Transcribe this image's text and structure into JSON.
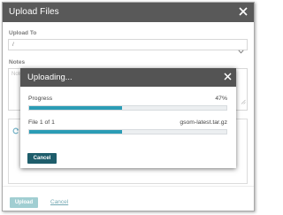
{
  "dialog": {
    "title": "Upload Files",
    "upload_to": {
      "label": "Upload To",
      "value": "/"
    },
    "notes": {
      "label": "Notes",
      "placeholder": "Notes"
    },
    "footer": {
      "upload_label": "Upload",
      "cancel_label": "Cancel"
    }
  },
  "progress_modal": {
    "title": "Uploading...",
    "progress": {
      "label": "Progress",
      "value": "47%",
      "fraction": 0.47
    },
    "file": {
      "label": "File 1 of 1",
      "name": "gsom-latest.tar.gz",
      "fraction": 0.47
    },
    "cancel_label": "Cancel"
  },
  "colors": {
    "titlebar": "#595959",
    "progress_fill": "#2b9cb5",
    "primary_button": "#6fb4bb",
    "modal_cancel_button": "#1e5d6b",
    "link": "#2a7a8a"
  },
  "icons": {
    "close": "close-icon",
    "dropdown": "chevron-down-icon",
    "refresh": "refresh-icon",
    "resize": "resize-grip-icon"
  }
}
